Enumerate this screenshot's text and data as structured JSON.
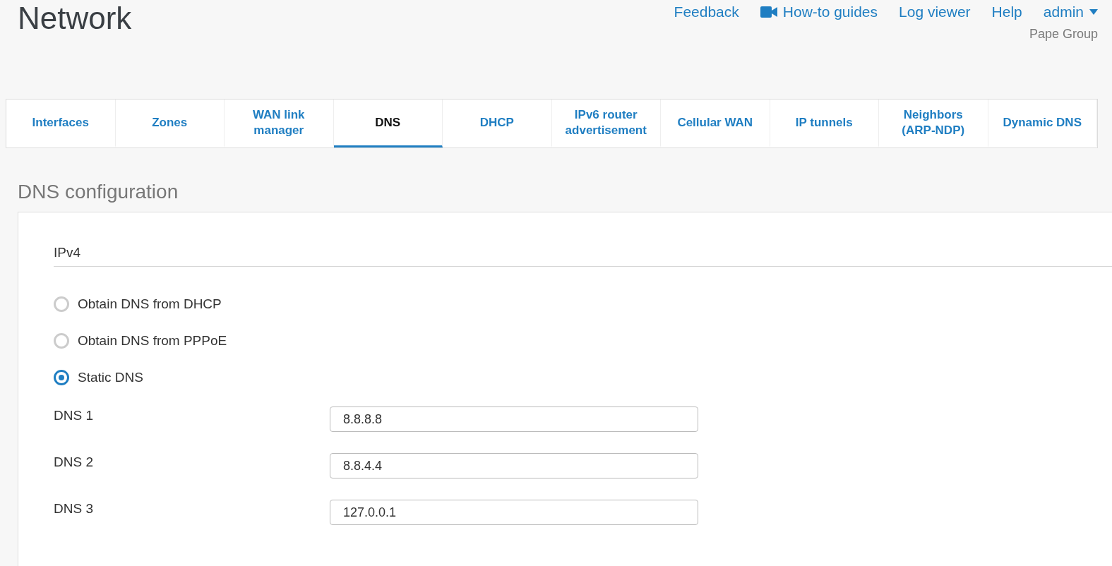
{
  "header": {
    "title": "Network",
    "links": [
      {
        "label": "Feedback",
        "kind": "link"
      },
      {
        "label": "How-to guides",
        "kind": "video"
      },
      {
        "label": "Log viewer",
        "kind": "link"
      },
      {
        "label": "Help",
        "kind": "link"
      },
      {
        "label": "admin",
        "kind": "menu"
      }
    ],
    "organization": "Pape Group"
  },
  "tabs": [
    {
      "label": "Interfaces",
      "selected": false
    },
    {
      "label": "Zones",
      "selected": false
    },
    {
      "label": "WAN link manager",
      "selected": false
    },
    {
      "label": "DNS",
      "selected": true
    },
    {
      "label": "DHCP",
      "selected": false
    },
    {
      "label": "IPv6 router advertisement",
      "selected": false
    },
    {
      "label": "Cellular WAN",
      "selected": false
    },
    {
      "label": "IP tunnels",
      "selected": false
    },
    {
      "label": "Neighbors (ARP-NDP)",
      "selected": false
    },
    {
      "label": "Dynamic DNS",
      "selected": false
    }
  ],
  "section": {
    "title": "DNS configuration",
    "group": "IPv4",
    "options": [
      {
        "label": "Obtain DNS from DHCP",
        "selected": false
      },
      {
        "label": "Obtain DNS from PPPoE",
        "selected": false
      },
      {
        "label": "Static DNS",
        "selected": true
      }
    ],
    "fields": [
      {
        "label": "DNS 1",
        "value": "8.8.8.8"
      },
      {
        "label": "DNS 2",
        "value": "8.8.4.4"
      },
      {
        "label": "DNS 3",
        "value": "127.0.0.1"
      }
    ]
  }
}
